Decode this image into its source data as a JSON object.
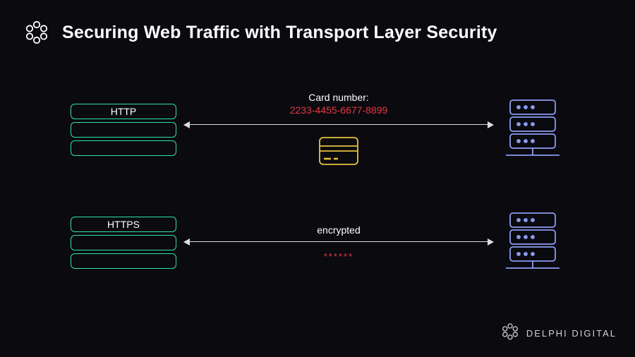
{
  "title": "Securing Web Traffic with Transport Layer Security",
  "brand": {
    "footer": "DELPHI DIGITAL"
  },
  "rows": {
    "http": {
      "protocol_label": "HTTP",
      "caption_line1": "Card number:",
      "caption_line2": "2233-4455-6677-8899"
    },
    "https": {
      "protocol_label": "HTTPS",
      "caption_line1": "encrypted",
      "masked": "******"
    }
  },
  "colors": {
    "accent_green": "#2fe3a3",
    "server_blue": "#8c9cf2",
    "card_yellow": "#e7c23c",
    "danger_red": "#e63946"
  }
}
